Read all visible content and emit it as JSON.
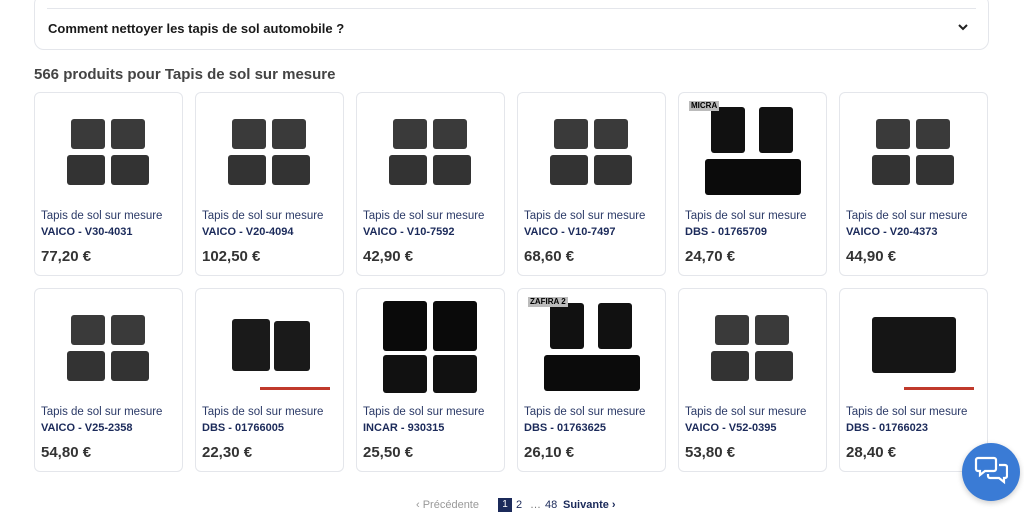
{
  "faq": {
    "question": "Comment nettoyer les tapis de sol automobile ?"
  },
  "listing": {
    "heading": "566 produits pour Tapis de sol sur mesure"
  },
  "products": [
    {
      "name": "Tapis de sol sur mesure",
      "ref": "VAICO - V30-4031",
      "price": "77,20 €",
      "style": "set4",
      "tag": ""
    },
    {
      "name": "Tapis de sol sur mesure",
      "ref": "VAICO - V20-4094",
      "price": "102,50 €",
      "style": "set4",
      "tag": ""
    },
    {
      "name": "Tapis de sol sur mesure",
      "ref": "VAICO - V10-7592",
      "price": "42,90 €",
      "style": "set4",
      "tag": ""
    },
    {
      "name": "Tapis de sol sur mesure",
      "ref": "VAICO - V10-7497",
      "price": "68,60 €",
      "style": "set4",
      "tag": ""
    },
    {
      "name": "Tapis de sol sur mesure",
      "ref": "DBS - 01765709",
      "price": "24,70 €",
      "style": "black3",
      "tag": "MICRA"
    },
    {
      "name": "Tapis de sol sur mesure",
      "ref": "VAICO - V20-4373",
      "price": "44,90 €",
      "style": "set4",
      "tag": ""
    },
    {
      "name": "Tapis de sol sur mesure",
      "ref": "VAICO - V25-2358",
      "price": "54,80 €",
      "style": "set4",
      "tag": ""
    },
    {
      "name": "Tapis de sol sur mesure",
      "ref": "DBS - 01766005",
      "price": "22,30 €",
      "style": "pair",
      "tag": ""
    },
    {
      "name": "Tapis de sol sur mesure",
      "ref": "INCAR - 930315",
      "price": "25,50 €",
      "style": "black4",
      "tag": ""
    },
    {
      "name": "Tapis de sol sur mesure",
      "ref": "DBS - 01763625",
      "price": "26,10 €",
      "style": "black3",
      "tag": "ZAFIRA 2"
    },
    {
      "name": "Tapis de sol sur mesure",
      "ref": "VAICO - V52-0395",
      "price": "53,80 €",
      "style": "set4",
      "tag": ""
    },
    {
      "name": "Tapis de sol sur mesure",
      "ref": "DBS - 01766023",
      "price": "28,40 €",
      "style": "single",
      "tag": ""
    }
  ],
  "pagination": {
    "prev": "‹ Précédente",
    "current": "1",
    "page2": "2",
    "dots": "…",
    "last": "48",
    "next": "Suivante ›"
  },
  "colors": {
    "accent": "#1b2a5a",
    "chat": "#3a7bd5"
  },
  "icons": {
    "faq_toggle": "chevron-down-icon",
    "chat": "chat-bubbles-icon"
  }
}
